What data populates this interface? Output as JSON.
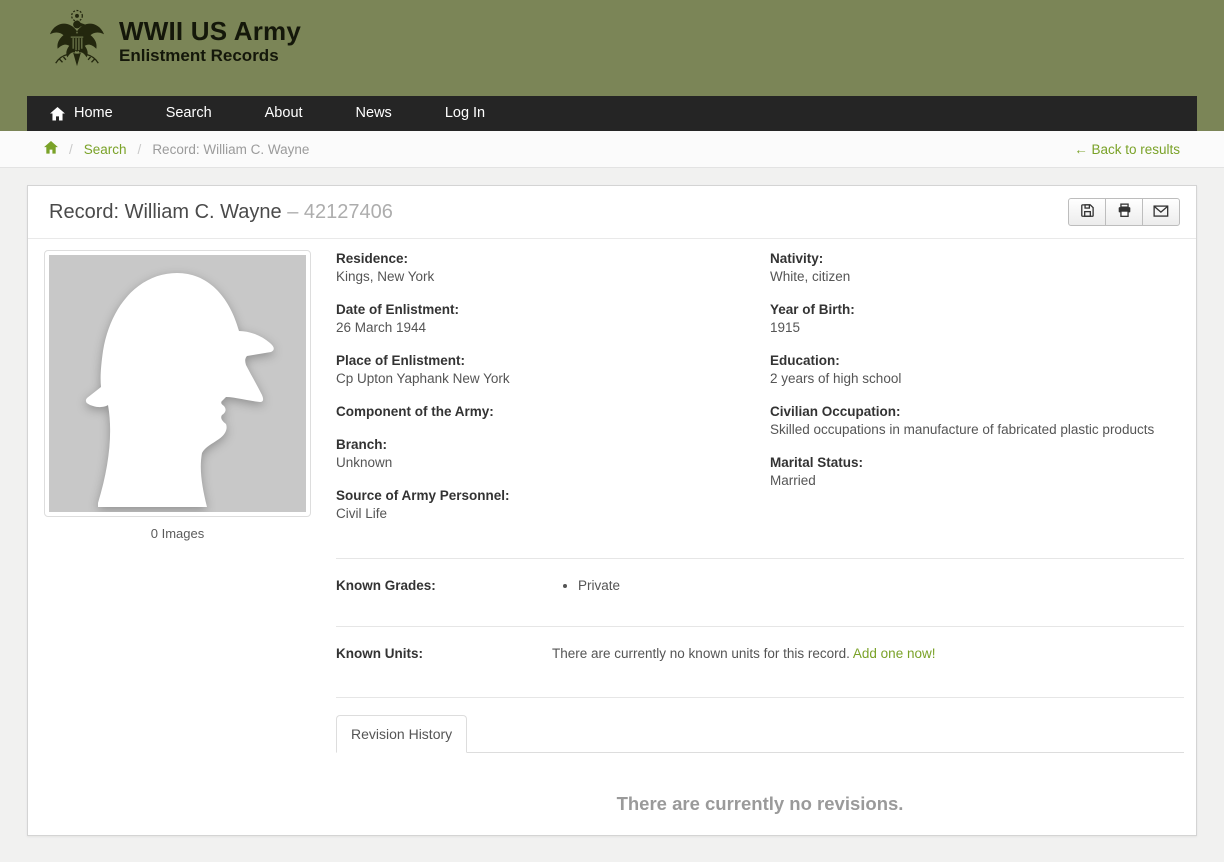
{
  "theme": {
    "header_green": "#7b8557",
    "nav_dark": "#252525",
    "accent_green": "#7aa228",
    "image_placeholder_gray": "#c8c8c8"
  },
  "site": {
    "brand_title": "WWII US Army",
    "brand_subtitle": "Enlistment Records",
    "logo_icon": "us-great-seal-eagle"
  },
  "nav": {
    "items": [
      {
        "icon": "home-icon",
        "label": "Home"
      },
      {
        "label": "Search"
      },
      {
        "label": "About"
      },
      {
        "label": "News"
      }
    ],
    "login_label": "Log In"
  },
  "breadcrumb": {
    "home_icon": "home-icon",
    "separator": "/",
    "items": [
      "Search",
      "Record: William C. Wayne"
    ],
    "back_link": "← Back to results"
  },
  "record": {
    "title": "Record: William C. Wayne",
    "title_separator": "–",
    "record_number": "42127406",
    "toolbar_icons": [
      "save-icon",
      "print-icon",
      "email-icon"
    ],
    "image_caption": "0 Images",
    "fields_left": [
      {
        "label": "Residence:",
        "value": "Kings, New York"
      },
      {
        "label": "Date of Enlistment:",
        "value": "26 March 1944"
      },
      {
        "label": "Place of Enlistment:",
        "value": "Cp Upton Yaphank New York"
      },
      {
        "label": "Component of the Army:",
        "value": ""
      },
      {
        "label": "Branch:",
        "value": "Unknown"
      },
      {
        "label": "Source of Army Personnel:",
        "value": "Civil Life"
      }
    ],
    "fields_right": [
      {
        "label": "Nativity:",
        "value": "White, citizen"
      },
      {
        "label": "Year of Birth:",
        "value": "1915"
      },
      {
        "label": "Education:",
        "value": "2 years of high school"
      },
      {
        "label": "Civilian Occupation:",
        "value": "Skilled occupations in manufacture of fabricated plastic products"
      },
      {
        "label": "Marital Status:",
        "value": "Married"
      }
    ],
    "known_grades": {
      "label": "Known Grades:",
      "items": [
        "Private"
      ]
    },
    "known_units": {
      "label": "Known Units:",
      "text": "There are currently no known units for this record.",
      "link": "Add one now",
      "link_suffix": "!"
    },
    "tabs": [
      {
        "label": "Revision History",
        "active": true
      }
    ],
    "revisions_empty": "There are currently no revisions."
  }
}
